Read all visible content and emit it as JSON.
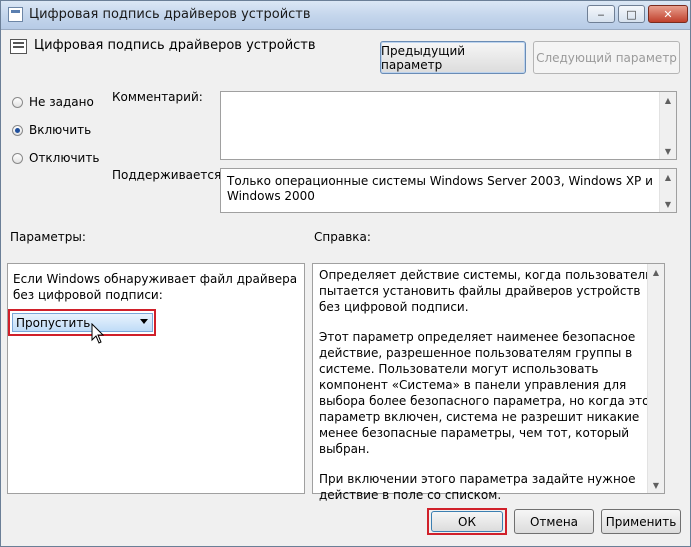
{
  "window": {
    "title": "Цифровая подпись драйверов устройств",
    "minimize_symbol": "‒",
    "maximize_symbol": "□",
    "close_symbol": "✕"
  },
  "header": {
    "policy_name": "Цифровая подпись драйверов устройств",
    "prev_button": "Предыдущий параметр",
    "next_button": "Следующий параметр"
  },
  "state": {
    "options": [
      {
        "label": "Не задано",
        "selected": false
      },
      {
        "label": "Включить",
        "selected": true
      },
      {
        "label": "Отключить",
        "selected": false
      }
    ]
  },
  "comment": {
    "label": "Комментарий:",
    "value": ""
  },
  "supported": {
    "label": "Поддерживается:",
    "value": "Только операционные системы Windows Server 2003, Windows XP и Windows 2000"
  },
  "options_panel": {
    "label": "Параметры:",
    "description": "Если Windows обнаруживает файл драйвера без цифровой подписи:",
    "combo_value": "Пропустить"
  },
  "help_panel": {
    "label": "Справка:",
    "paragraphs": [
      "Определяет действие системы, когда пользователь пытается установить файлы драйверов устройств без цифровой подписи.",
      "Этот параметр определяет наименее безопасное действие, разрешенное пользователям группы в системе. Пользователи могут использовать компонент «Система» в панели управления для выбора более безопасного параметра, но когда этот параметр включен, система не разрешит никакие менее безопасные параметры, чем тот, который выбран.",
      "При включении этого параметра задайте нужное действие в поле со списком."
    ]
  },
  "footer": {
    "ok": "ОК",
    "cancel": "Отмена",
    "apply": "Применить"
  },
  "icons": {
    "scroll_up": "▲",
    "scroll_down": "▼"
  },
  "colors": {
    "highlight": "#d0202a",
    "selected_combo": "#bfdcf7"
  }
}
